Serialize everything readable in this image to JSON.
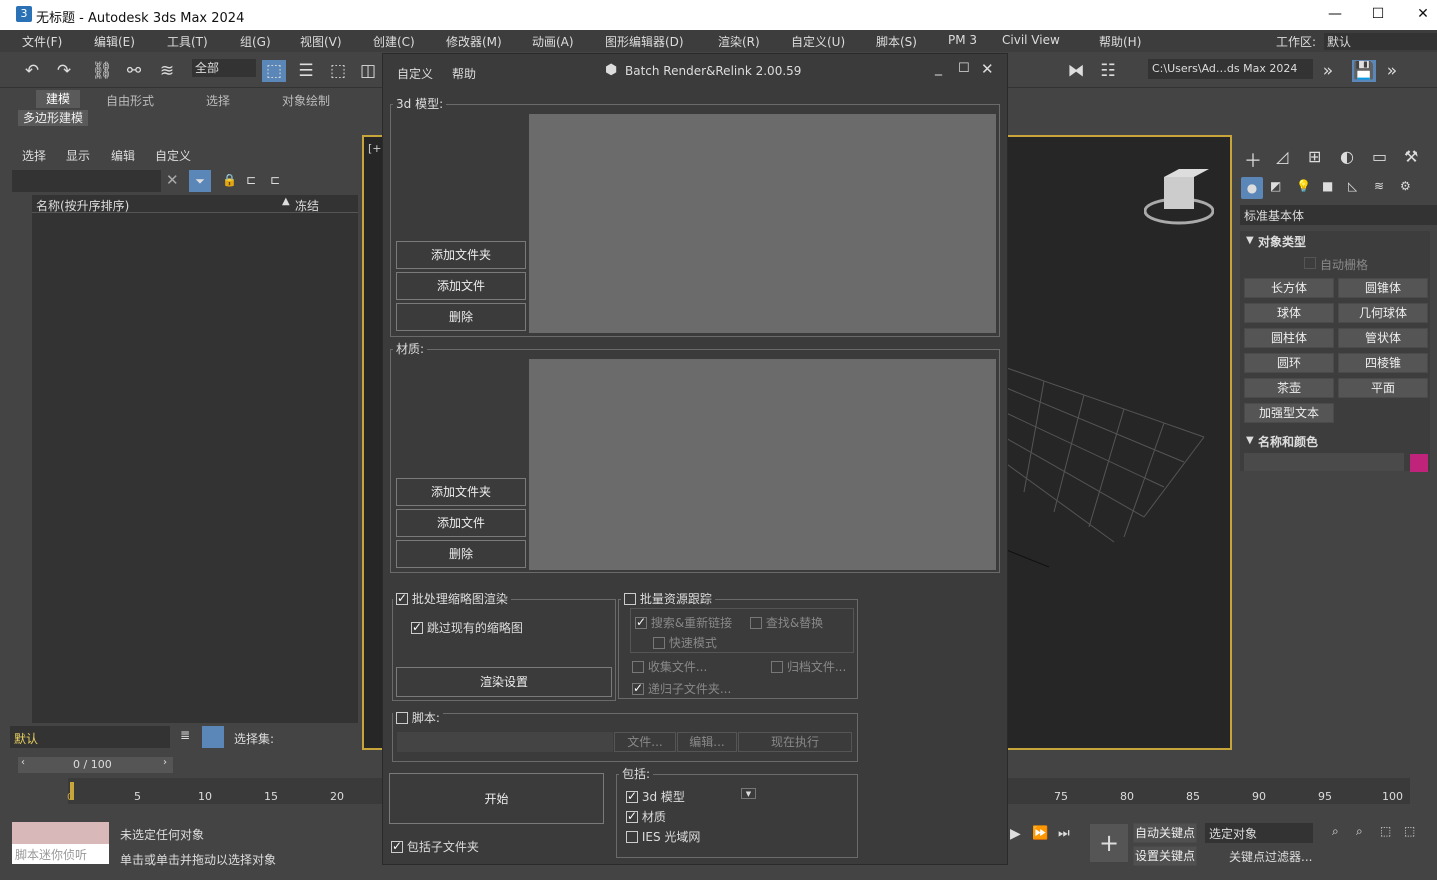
{
  "window": {
    "title": "无标题 - Autodesk 3ds Max 2024",
    "logo": "3"
  },
  "menu": [
    "文件(F)",
    "编辑(E)",
    "工具(T)",
    "组(G)",
    "视图(V)",
    "创建(C)",
    "修改器(M)",
    "动画(A)",
    "图形编辑器(D)",
    "渲染(R)",
    "自定义(U)",
    "脚本(S)",
    "PM 3",
    "Civil View",
    "帮助(H)"
  ],
  "workspace": {
    "label": "工作区:",
    "value": "默认"
  },
  "toolbar": {
    "filter": "全部",
    "path": "C:\\Users\\Ad…ds Max 2024"
  },
  "ribbon": {
    "tabs": [
      "建模",
      "自由形式",
      "选择",
      "对象绘制"
    ],
    "sub": "多边形建模"
  },
  "scene": {
    "tabs": [
      "选择",
      "显示",
      "编辑",
      "自定义"
    ],
    "col_name": "名称(按升序排序)",
    "col_frozen": "冻结",
    "layer": "默认",
    "selset": "选择集:"
  },
  "viewport": {
    "label": "[+"
  },
  "rpanel": {
    "dropdown": "标准基本体",
    "sec1": "对象类型",
    "autogrid": "自动栅格",
    "buttons": [
      "长方体",
      "圆锥体",
      "球体",
      "几何球体",
      "圆柱体",
      "管状体",
      "圆环",
      "四棱锥",
      "茶壶",
      "平面",
      "加强型文本"
    ],
    "sec2": "名称和颜色",
    "color": "#c0237a"
  },
  "timeline": {
    "frame": "0 / 100",
    "ticks": [
      "0",
      "5",
      "10",
      "15",
      "20",
      "75",
      "80",
      "85",
      "90",
      "95",
      "100"
    ]
  },
  "status": {
    "line1": "未选定任何对象",
    "line2": "单击或单击并拖动以选择对象",
    "script": "脚本迷你侦听"
  },
  "anim": {
    "autokey": "自动关键点",
    "setkey": "设置关键点",
    "selected": "选定对象",
    "filter": "关键点过滤器..."
  },
  "dialog": {
    "menu": [
      "自定义",
      "帮助"
    ],
    "title": "Batch Render&Relink 2.00.59",
    "models_label": "3d 模型:",
    "materials_label": "材质:",
    "add_folder": "添加文件夹",
    "add_file": "添加文件",
    "delete": "删除",
    "batch_thumb": "批处理缩略图渲染",
    "skip_thumb": "跳过现有的缩略图",
    "render_settings": "渲染设置",
    "batch_res": "批量资源跟踪",
    "search_relink": "搜索&重新链接",
    "find_replace": "查找&替换",
    "fast_mode": "快速模式",
    "collect": "收集文件...",
    "archive": "归档文件...",
    "recurse": "递归子文件夹...",
    "script": "脚本:",
    "file": "文件...",
    "edit": "编辑...",
    "run": "现在执行",
    "start": "开始",
    "include_sub": "包括子文件夹",
    "include": "包括:",
    "inc_model": "3d 模型",
    "inc_mat": "材质",
    "inc_ies": "IES 光域网"
  }
}
